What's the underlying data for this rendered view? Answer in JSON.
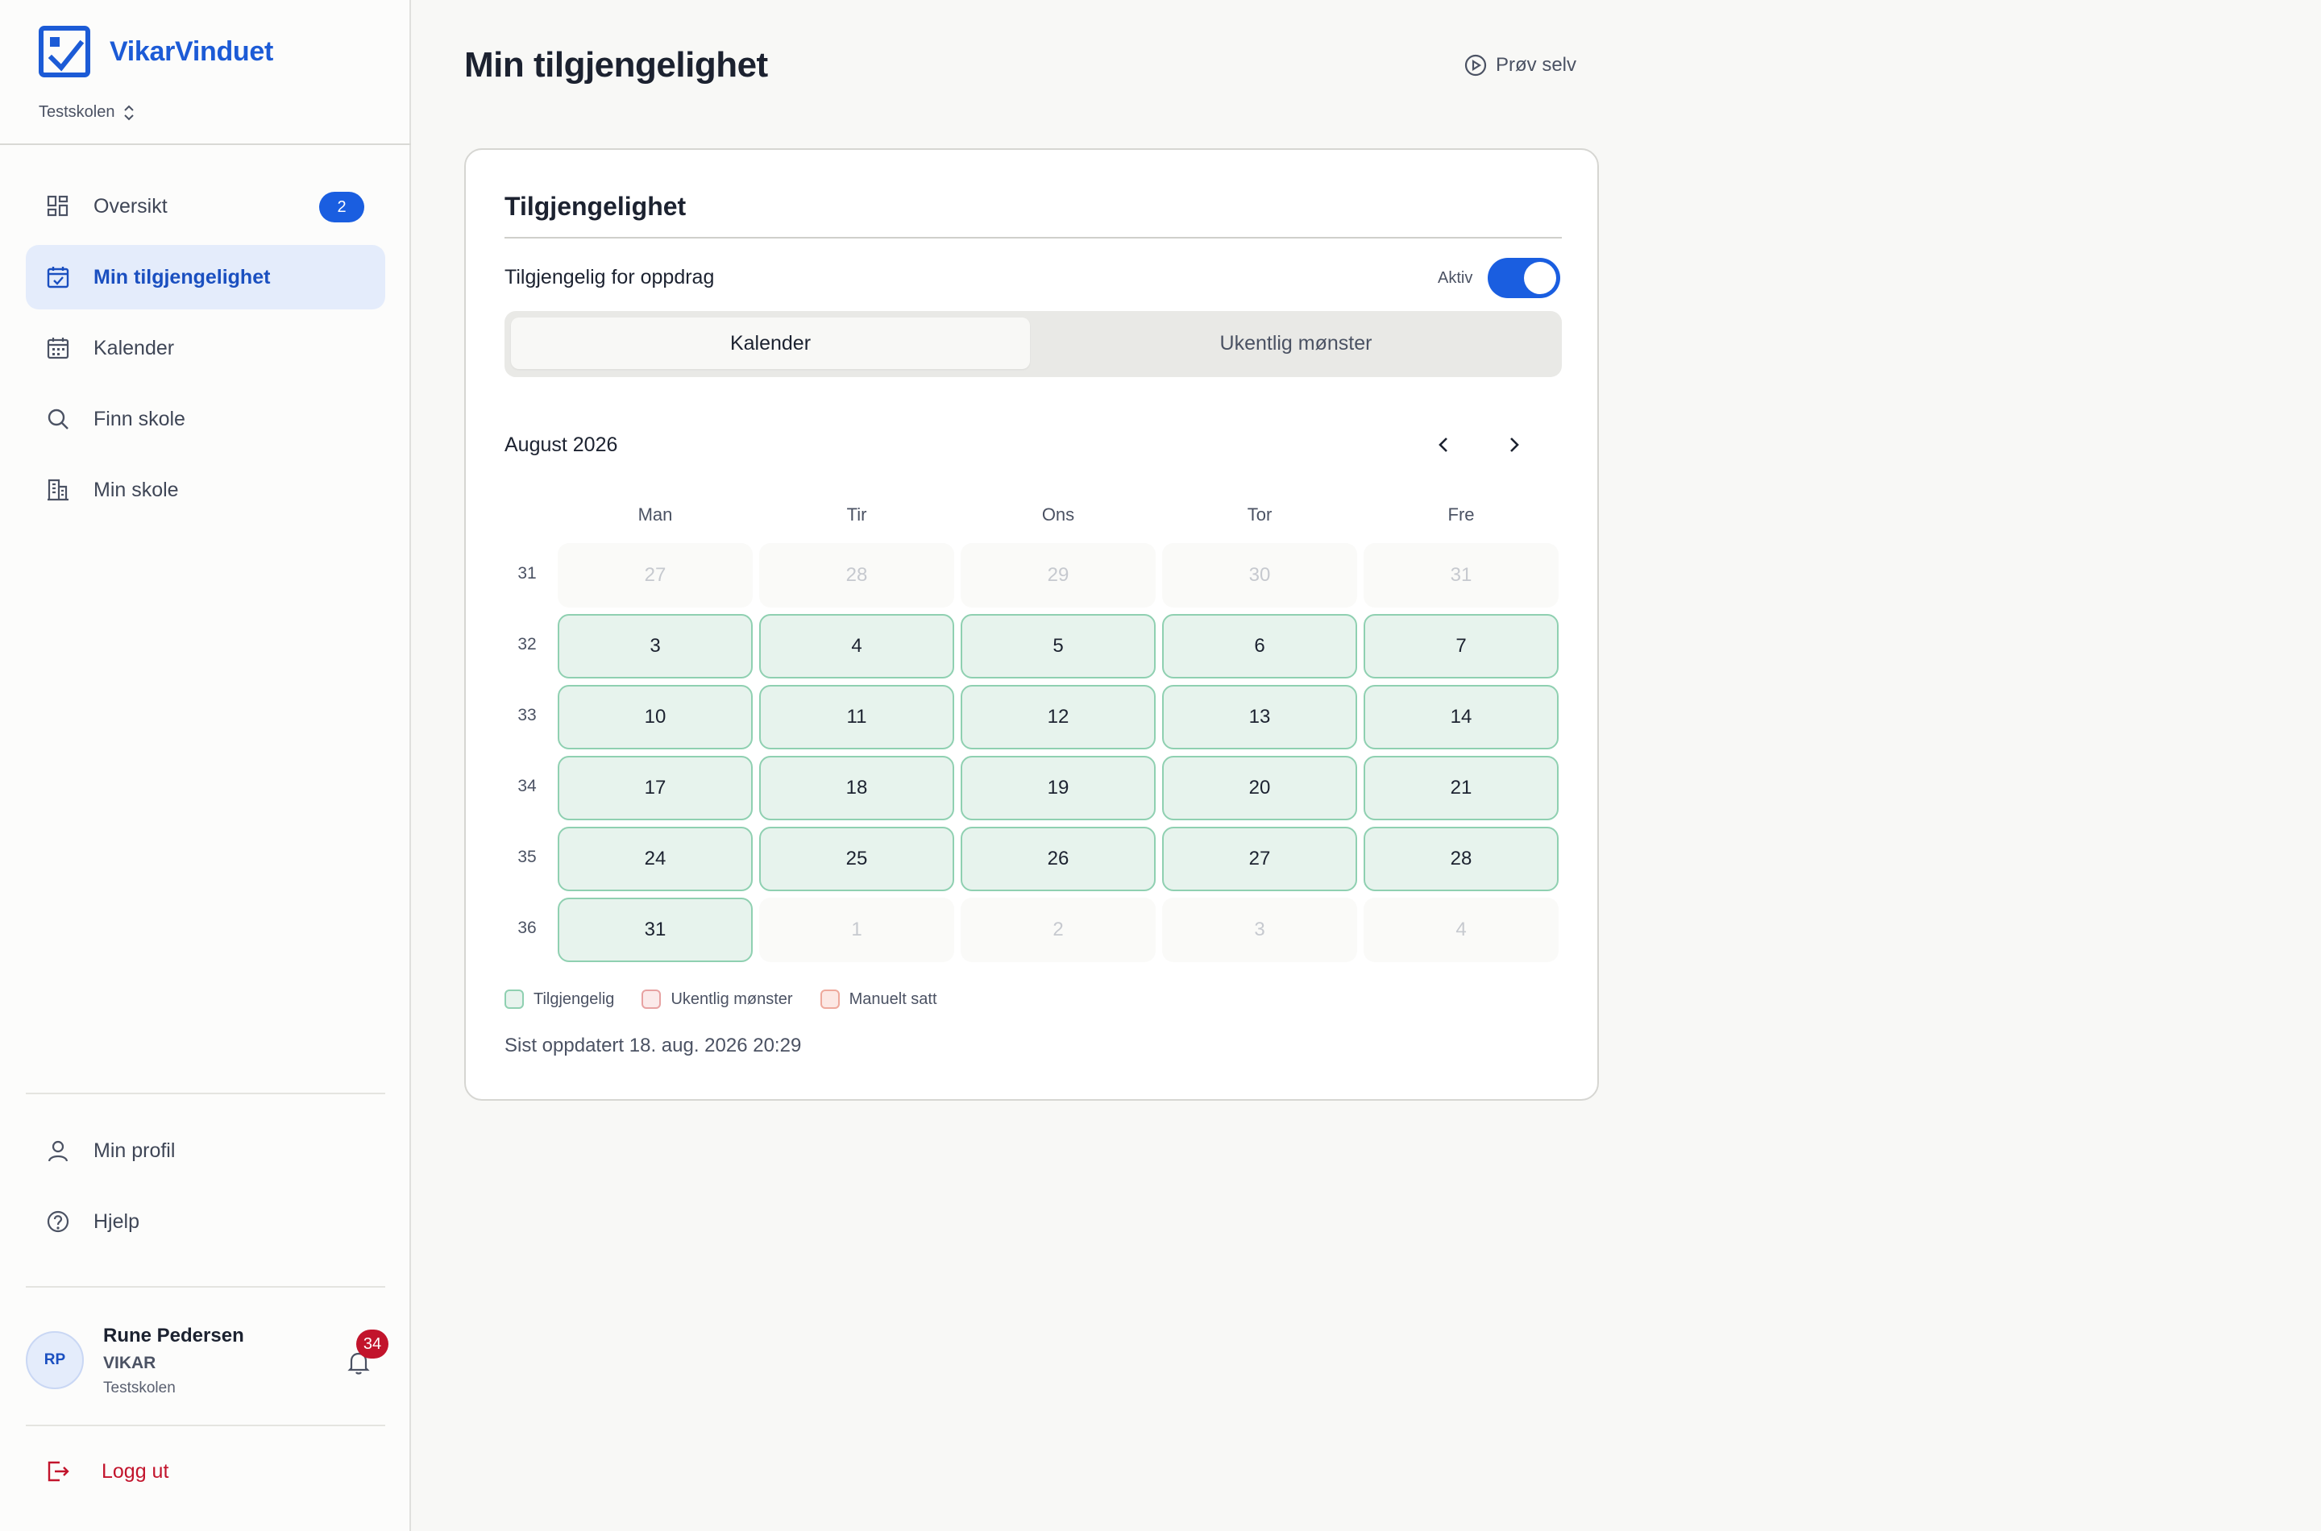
{
  "app": {
    "name": "VikarVinduet",
    "school_switch": "Testskolen"
  },
  "nav": {
    "items": [
      {
        "label": "Oversikt",
        "icon": "dashboard-icon",
        "badge": "2"
      },
      {
        "label": "Min tilgjengelighet",
        "icon": "calendar-check-icon",
        "active": true
      },
      {
        "label": "Kalender",
        "icon": "calendar-icon"
      },
      {
        "label": "Finn skole",
        "icon": "search-icon"
      },
      {
        "label": "Min skole",
        "icon": "building-icon"
      }
    ],
    "bottom": [
      {
        "label": "Min profil",
        "icon": "user-icon"
      },
      {
        "label": "Hjelp",
        "icon": "help-icon"
      }
    ],
    "logout": "Logg ut"
  },
  "user": {
    "initials": "RP",
    "name": "Rune Pedersen",
    "role": "VIKAR",
    "school": "Testskolen",
    "notifications": "34"
  },
  "page": {
    "title": "Min tilgjengelighet",
    "try_button": "Prøv selv"
  },
  "card": {
    "title": "Tilgjengelighet",
    "available_label": "Tilgjengelig for oppdrag",
    "toggle_label": "Aktiv",
    "toggle_on": true,
    "tabs": [
      "Kalender",
      "Ukentlig mønster"
    ],
    "active_tab": "Kalender",
    "month": "August 2026",
    "weekdays": [
      "Man",
      "Tir",
      "Ons",
      "Tor",
      "Fre"
    ],
    "weeks": [
      {
        "week": "31",
        "days": [
          {
            "d": "27",
            "in": false
          },
          {
            "d": "28",
            "in": false
          },
          {
            "d": "29",
            "in": false
          },
          {
            "d": "30",
            "in": false
          },
          {
            "d": "31",
            "in": false
          }
        ]
      },
      {
        "week": "32",
        "days": [
          {
            "d": "3",
            "in": true
          },
          {
            "d": "4",
            "in": true
          },
          {
            "d": "5",
            "in": true
          },
          {
            "d": "6",
            "in": true
          },
          {
            "d": "7",
            "in": true
          }
        ]
      },
      {
        "week": "33",
        "days": [
          {
            "d": "10",
            "in": true
          },
          {
            "d": "11",
            "in": true
          },
          {
            "d": "12",
            "in": true
          },
          {
            "d": "13",
            "in": true
          },
          {
            "d": "14",
            "in": true
          }
        ]
      },
      {
        "week": "34",
        "days": [
          {
            "d": "17",
            "in": true
          },
          {
            "d": "18",
            "in": true
          },
          {
            "d": "19",
            "in": true
          },
          {
            "d": "20",
            "in": true
          },
          {
            "d": "21",
            "in": true
          }
        ]
      },
      {
        "week": "35",
        "days": [
          {
            "d": "24",
            "in": true
          },
          {
            "d": "25",
            "in": true
          },
          {
            "d": "26",
            "in": true
          },
          {
            "d": "27",
            "in": true
          },
          {
            "d": "28",
            "in": true
          }
        ]
      },
      {
        "week": "36",
        "days": [
          {
            "d": "31",
            "in": true
          },
          {
            "d": "1",
            "in": false
          },
          {
            "d": "2",
            "in": false
          },
          {
            "d": "3",
            "in": false
          },
          {
            "d": "4",
            "in": false
          }
        ]
      }
    ],
    "legend": [
      {
        "label": "Tilgjengelig",
        "color": "#8fd0b1"
      },
      {
        "label": "Ukentlig mønster",
        "color": "#e7a2a2"
      },
      {
        "label": "Manuelt satt",
        "color": "#eea99c"
      }
    ],
    "updated": "Sist oppdatert 18. aug. 2026 20:29"
  },
  "colors": {
    "brand": "#1c5bd6",
    "accent": "#1a5ee0",
    "danger": "#c2142c",
    "available": "#e7f3ed"
  }
}
